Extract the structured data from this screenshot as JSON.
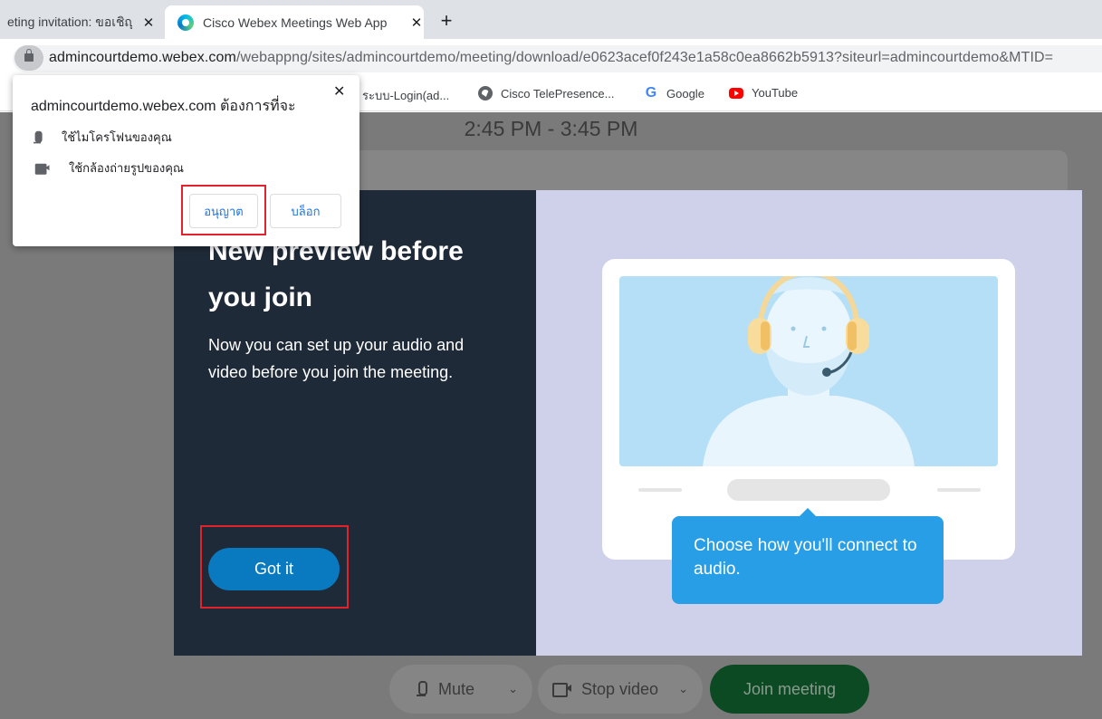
{
  "browser": {
    "tabs": [
      {
        "title": "eting invitation: ขอเชิญ",
        "active": false
      },
      {
        "title": "Cisco Webex Meetings Web App",
        "active": true
      }
    ],
    "new_tab_label": "+",
    "close_label": "✕",
    "url_host": "admincourtdemo.webex.com",
    "url_path": "/webappng/sites/admincourtdemo/meeting/download/e0623acef0f243e1a58c0ea8662b5913?siteurl=admincourtdemo&MTID=",
    "bookmarks": [
      {
        "label": "ระบบ-Login(ad...",
        "icon": "bookmark-icon"
      },
      {
        "label": "Cisco TelePresence...",
        "icon": "globe-icon"
      },
      {
        "label": "Google",
        "icon": "google-icon"
      },
      {
        "label": "YouTube",
        "icon": "youtube-icon"
      }
    ]
  },
  "permission_popup": {
    "title": "admincourtdemo.webex.com ต้องการที่จะ",
    "close_label": "✕",
    "items": [
      {
        "label": "ใช้ไมโครโฟนของคุณ",
        "icon": "microphone-icon"
      },
      {
        "label": "ใช้กล้องถ่ายรูปของคุณ",
        "icon": "camera-icon"
      }
    ],
    "allow_label": "อนุญาต",
    "block_label": "บล็อก"
  },
  "meeting": {
    "time": "2:45 PM - 3:45 PM"
  },
  "modal": {
    "title": "New preview before you join",
    "description": "Now you can set up your audio and video before you join the meeting.",
    "got_it_label": "Got it",
    "bubble_text": "Choose how you'll connect to audio."
  },
  "controls": {
    "mute_label": "Mute",
    "stop_video_label": "Stop video",
    "join_label": "Join meeting",
    "chevron": "⌄"
  },
  "colors": {
    "modal_left_bg": "#1f2a38",
    "modal_right_bg": "#cfd1eb",
    "got_it_bg": "#0a7ac0",
    "bubble_bg": "#279ee6",
    "highlight_red": "#e0232d",
    "join_bg": "#0c4a24"
  }
}
